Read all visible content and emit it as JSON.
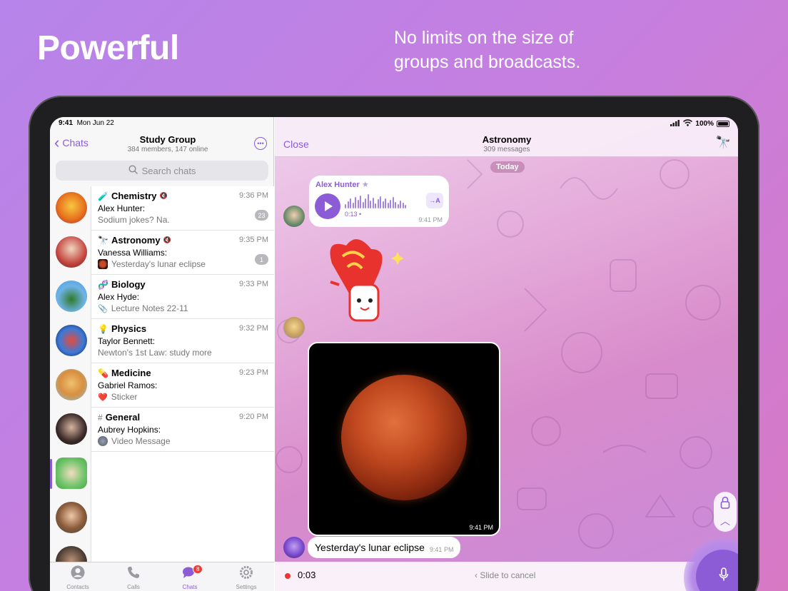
{
  "promo": {
    "headline": "Powerful",
    "subhead": "No limits on the size of groups and broadcasts."
  },
  "status_bar": {
    "time": "9:41",
    "date": "Mon Jun 22",
    "battery": "100%"
  },
  "left_header": {
    "back_label": "Chats",
    "title": "Study Group",
    "subtitle": "384 members, 147 online"
  },
  "search": {
    "placeholder": "Search chats"
  },
  "chats": [
    {
      "icon": "🧪",
      "title": "Chemistry",
      "muted": true,
      "time": "9:36 PM",
      "sender": "Alex Hunter:",
      "preview": "Sodium jokes? Na.",
      "badge": "23"
    },
    {
      "icon": "🔭",
      "title": "Astronomy",
      "muted": true,
      "time": "9:35 PM",
      "sender": "Vanessa Williams:",
      "preview": "Yesterday's lunar eclipse",
      "badge": "1"
    },
    {
      "icon": "🧬",
      "title": "Biology",
      "muted": false,
      "time": "9:33 PM",
      "sender": "Alex Hyde:",
      "preview": "Lecture Notes 22-11",
      "badge": ""
    },
    {
      "icon": "💡",
      "title": "Physics",
      "muted": false,
      "time": "9:32 PM",
      "sender": "Taylor Bennett:",
      "preview": "Newton's 1st Law: study more",
      "badge": ""
    },
    {
      "icon": "💊",
      "title": "Medicine",
      "muted": false,
      "time": "9:23 PM",
      "sender": "Gabriel Ramos:",
      "preview": "Sticker",
      "badge": ""
    },
    {
      "icon": "#",
      "title": "General",
      "muted": false,
      "time": "9:20 PM",
      "sender": "Aubrey Hopkins:",
      "preview": "Video Message",
      "badge": ""
    }
  ],
  "preview_icons": [
    "",
    "moon-thumbnail",
    "📎",
    "",
    "❤️",
    "video-thumbnail"
  ],
  "tabbar": {
    "tabs": [
      {
        "label": "Contacts",
        "icon": "person-circle-icon"
      },
      {
        "label": "Calls",
        "icon": "phone-icon"
      },
      {
        "label": "Chats",
        "icon": "chat-bubbles-icon",
        "badge": "8",
        "active": true
      },
      {
        "label": "Settings",
        "icon": "gear-icon"
      }
    ]
  },
  "conversation": {
    "close_label": "Close",
    "title": "Astronomy",
    "subtitle": "309 messages",
    "date_separator": "Today",
    "voice_message": {
      "sender": "Alex Hunter",
      "duration": "0:13",
      "time": "9:41 PM",
      "transcribe_label": "→A"
    },
    "photo_time": "9:41 PM",
    "caption": "Yesterday's lunar eclipse",
    "caption_time": "9:41 PM"
  },
  "recording": {
    "elapsed": "0:03",
    "slide_hint": "Slide to cancel"
  },
  "colors": {
    "accent": "#8b5cd6",
    "badge_red": "#f03a35",
    "recording_red": "#ee3535"
  }
}
